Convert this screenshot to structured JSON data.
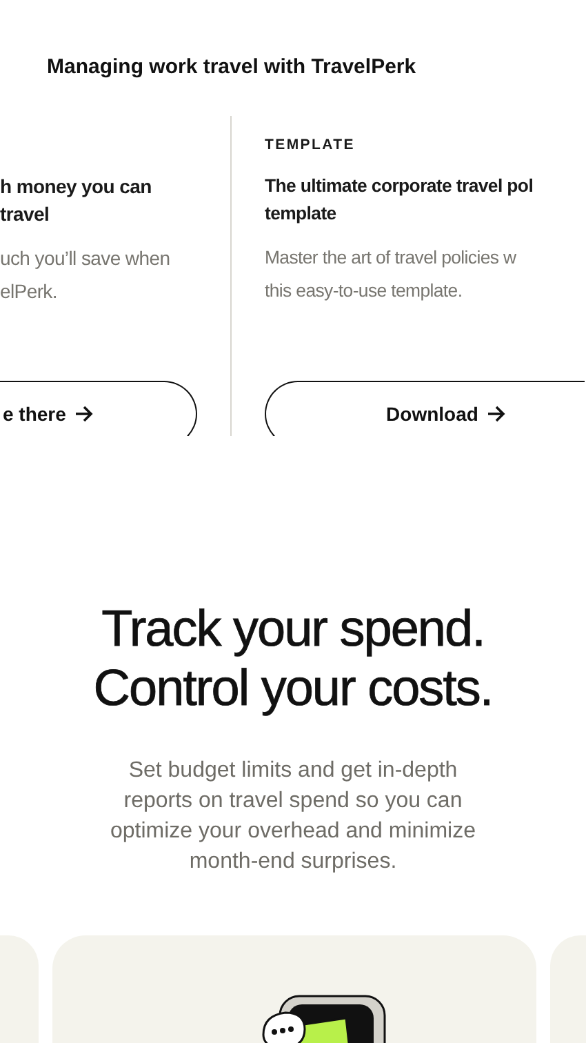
{
  "section_title": "Managing work travel with TravelPerk",
  "cards": [
    {
      "title_lines": [
        "h money you can",
        "travel"
      ],
      "body_lines": [
        "uch you’ll save when",
        "elPerk."
      ],
      "button": "e there"
    },
    {
      "eyebrow": "TEMPLATE",
      "title_lines": [
        "The ultimate corporate travel pol",
        "template"
      ],
      "body_lines": [
        "Master the art of travel policies w",
        "this easy-to-use template."
      ],
      "button": "Download"
    }
  ],
  "feature": {
    "headline": "Track your spend. Control your costs.",
    "description": "Set budget limits and get in-depth reports on travel spend so you can optimize your overhead and minimize month-end surprises."
  }
}
